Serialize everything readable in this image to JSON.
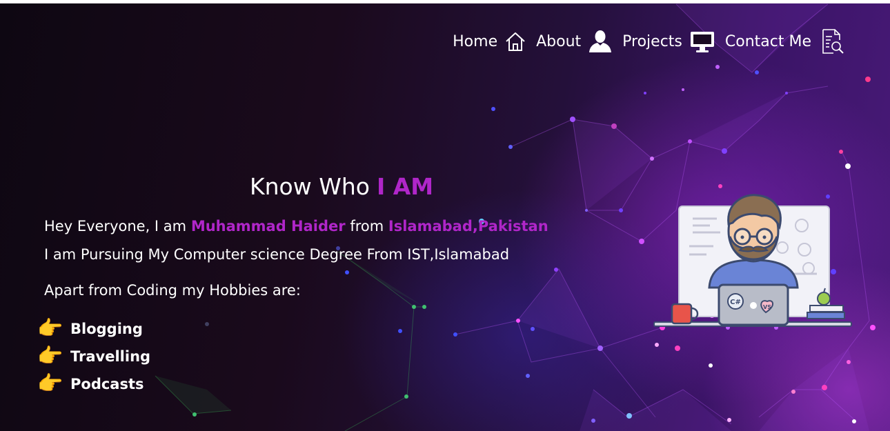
{
  "nav": {
    "items": [
      {
        "label": "Home",
        "icon": "home-icon"
      },
      {
        "label": "About",
        "icon": "user-icon"
      },
      {
        "label": "Projects",
        "icon": "monitor-icon"
      },
      {
        "label": "Contact Me",
        "icon": "document-search-icon"
      }
    ]
  },
  "hero": {
    "title_prefix": "Know Who",
    "title_accent": "I AM",
    "intro_text": "Hey Everyone, I am",
    "name": "Muhammad Haider",
    "from_text": "from",
    "location": "Islamabad,Pakistan",
    "line2": "I am Pursuing My Computer science Degree From IST,Islamabad",
    "line3": "Apart from Coding my Hobbies are:",
    "hobbies": [
      {
        "emoji": "👉",
        "label": "Blogging"
      },
      {
        "emoji": "👉",
        "label": "Travelling"
      },
      {
        "emoji": "👉",
        "label": "Podcasts"
      }
    ],
    "laptop_stickers": [
      "C#",
      "VS"
    ]
  },
  "colors": {
    "accent": "#b026c9",
    "background_dark": "#0e0712",
    "background_purple": "#4a1a7a"
  }
}
